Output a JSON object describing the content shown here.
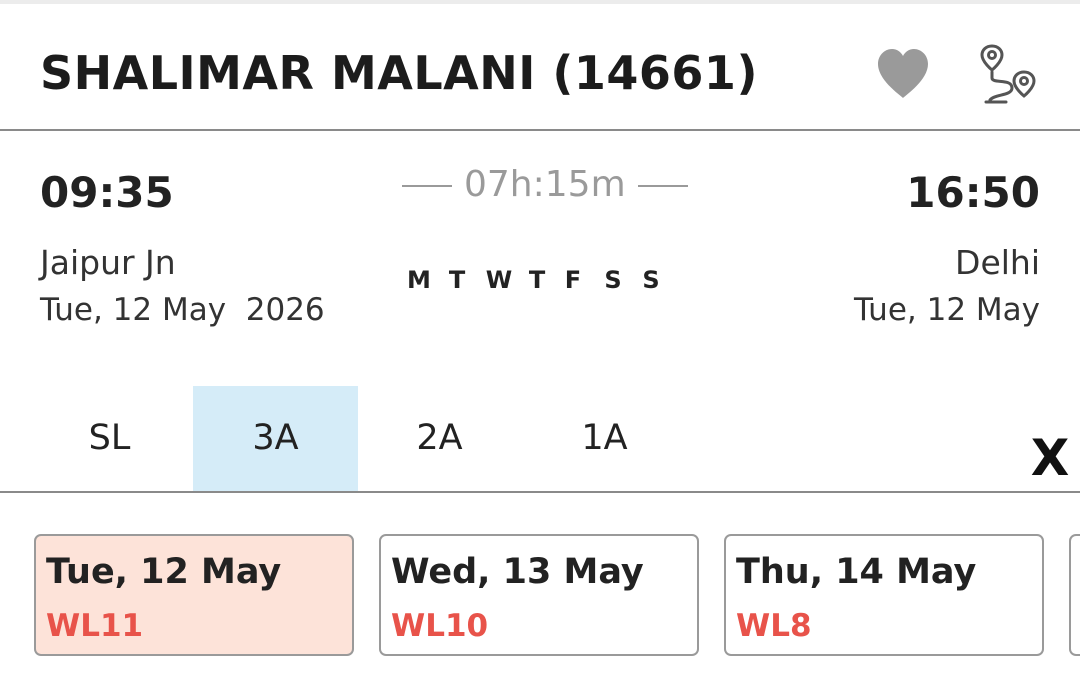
{
  "train": {
    "title": "SHALIMAR MALANI (14661)",
    "favorite_icon": "heart-icon",
    "route_icon": "route-map-icon"
  },
  "journey": {
    "departure_time": "09:35",
    "arrival_time": "16:50",
    "duration": "07h:15m",
    "from_station": "Jaipur Jn",
    "to_station": "Delhi",
    "departure_date": "Tue, 12 May  2026",
    "arrival_date": "Tue, 12 May",
    "run_days": [
      "M",
      "T",
      "W",
      "T",
      "F",
      "S",
      "S"
    ]
  },
  "classes": {
    "items": [
      "SL",
      "3A",
      "2A",
      "1A"
    ],
    "selected": "3A",
    "close_label": "X"
  },
  "availability": [
    {
      "date": "Tue, 12 May",
      "status": "WL11",
      "selected": true
    },
    {
      "date": "Wed, 13 May",
      "status": "WL10",
      "selected": false
    },
    {
      "date": "Thu, 14 May",
      "status": "WL8",
      "selected": false
    }
  ],
  "colors": {
    "selected_class_bg": "#d5ecf8",
    "selected_date_bg": "#fde3d9",
    "waitlist_text": "#e8534a",
    "icon_gray": "#9a9a9a"
  }
}
